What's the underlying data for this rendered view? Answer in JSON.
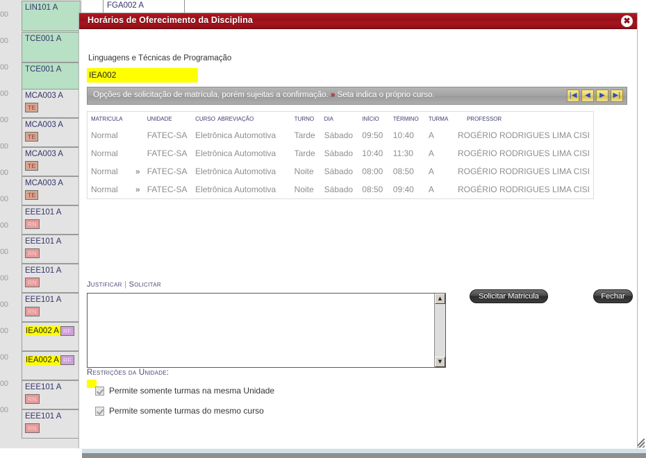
{
  "background": {
    "top_cell_label": "FGA002 A",
    "gutter_times": [
      "00",
      "00",
      "00",
      "00",
      "00",
      "00",
      "00",
      "00",
      "00",
      "00",
      "00",
      "00",
      "00",
      "00",
      "00",
      "00"
    ],
    "schedule_cells": [
      {
        "code": "LIN101 A",
        "badge": "",
        "badge_type": "",
        "green": true,
        "highlight": false
      },
      {
        "code": "TCE001 A",
        "badge": "",
        "badge_type": "",
        "green": true,
        "highlight": false
      },
      {
        "code": "TCE001 A",
        "badge": "",
        "badge_type": "",
        "green": true,
        "highlight": false
      },
      {
        "code": "MCA003 A",
        "badge": "TE",
        "badge_type": "te",
        "green": false,
        "highlight": false
      },
      {
        "code": "MCA003 A",
        "badge": "TE",
        "badge_type": "te",
        "green": false,
        "highlight": false
      },
      {
        "code": "MCA003 A",
        "badge": "TE",
        "badge_type": "te",
        "green": false,
        "highlight": false
      },
      {
        "code": "MCA003 A",
        "badge": "TE",
        "badge_type": "te",
        "green": false,
        "highlight": false
      },
      {
        "code": "EEE101 A",
        "badge": "RN",
        "badge_type": "rn",
        "green": false,
        "highlight": false
      },
      {
        "code": "EEE101 A",
        "badge": "RN",
        "badge_type": "rn",
        "green": false,
        "highlight": false
      },
      {
        "code": "EEE101 A",
        "badge": "RN",
        "badge_type": "rn",
        "green": false,
        "highlight": false
      },
      {
        "code": "EEE101 A",
        "badge": "RN",
        "badge_type": "rn",
        "green": false,
        "highlight": false
      },
      {
        "code": "IEA002 A",
        "badge": "RF",
        "badge_type": "rf",
        "green": false,
        "highlight": true
      },
      {
        "code": "IEA002 A",
        "badge": "RF",
        "badge_type": "rf",
        "green": false,
        "highlight": true
      },
      {
        "code": "EEE101 A",
        "badge": "RN",
        "badge_type": "rn",
        "green": false,
        "highlight": false
      },
      {
        "code": "EEE101 A",
        "badge": "RN",
        "badge_type": "rn",
        "green": false,
        "highlight": false
      }
    ]
  },
  "dialog": {
    "title": "Horários de Oferecimento da Disciplina",
    "close_icon": "✖",
    "discipline_name": "Linguagens e Técnicas de Programação",
    "discipline_code": "IEA002",
    "infobar": {
      "text_before": "Opções de solicitação de matrícula, porém sujeitas a confirmação.",
      "arrow": "»",
      "text_after": "Seta indica o próprio curso.",
      "pager": [
        {
          "name": "first",
          "glyph": "|◀"
        },
        {
          "name": "prev",
          "glyph": "◀"
        },
        {
          "name": "next",
          "glyph": "▶"
        },
        {
          "name": "last",
          "glyph": "▶|"
        }
      ]
    },
    "table": {
      "headers": [
        "Matricula",
        "",
        "Unidade",
        "Curso Abreviação",
        "Turno",
        "Dia",
        "Início",
        "Término",
        "Turma",
        "Professor"
      ],
      "rows": [
        {
          "matricula": "Normal",
          "arrow": "",
          "unidade": "FATEC-SA",
          "curso": "Eletrônica Automotiva",
          "turno": "Tarde",
          "dia": "Sábado",
          "inicio": "09:50",
          "termino": "10:40",
          "turma": "A",
          "professor": "ROGÉRIO RODRIGUES LIMA CISI"
        },
        {
          "matricula": "Normal",
          "arrow": "",
          "unidade": "FATEC-SA",
          "curso": "Eletrônica Automotiva",
          "turno": "Tarde",
          "dia": "Sábado",
          "inicio": "10:40",
          "termino": "11:30",
          "turma": "A",
          "professor": "ROGÉRIO RODRIGUES LIMA CISI"
        },
        {
          "matricula": "Normal",
          "arrow": "»",
          "unidade": "FATEC-SA",
          "curso": "Eletrônica Automotiva",
          "turno": "Noite",
          "dia": "Sábado",
          "inicio": "08:00",
          "termino": "08:50",
          "turma": "A",
          "professor": "ROGÉRIO RODRIGUES LIMA CISI"
        },
        {
          "matricula": "Normal",
          "arrow": "»",
          "unidade": "FATEC-SA",
          "curso": "Eletrônica Automotiva",
          "turno": "Noite",
          "dia": "Sábado",
          "inicio": "08:50",
          "termino": "09:40",
          "turma": "A",
          "professor": "ROGÉRIO RODRIGUES LIMA CISI"
        }
      ]
    },
    "justify": {
      "justificar_label": "Justificar",
      "separator": "|",
      "solicitar_label": "Solicitar",
      "textarea_value": "",
      "textarea_placeholder": ""
    },
    "buttons": {
      "solicitar_matricula": "Solicitar Matricula",
      "fechar": "Fechar"
    },
    "restrictions": {
      "title": "Restrições da Unidade:",
      "items": [
        {
          "label": "Permite somente turmas na mesma Unidade",
          "checked": true
        },
        {
          "label": "Permite somente turmas do mesmo curso",
          "checked": true
        }
      ]
    }
  },
  "colors": {
    "titlebar_red": "#a01520",
    "highlight_yellow": "#ffff00",
    "arrow_red": "#b3151f",
    "header_blue": "#3b3b72",
    "green_cell": "#b7e0c4"
  }
}
